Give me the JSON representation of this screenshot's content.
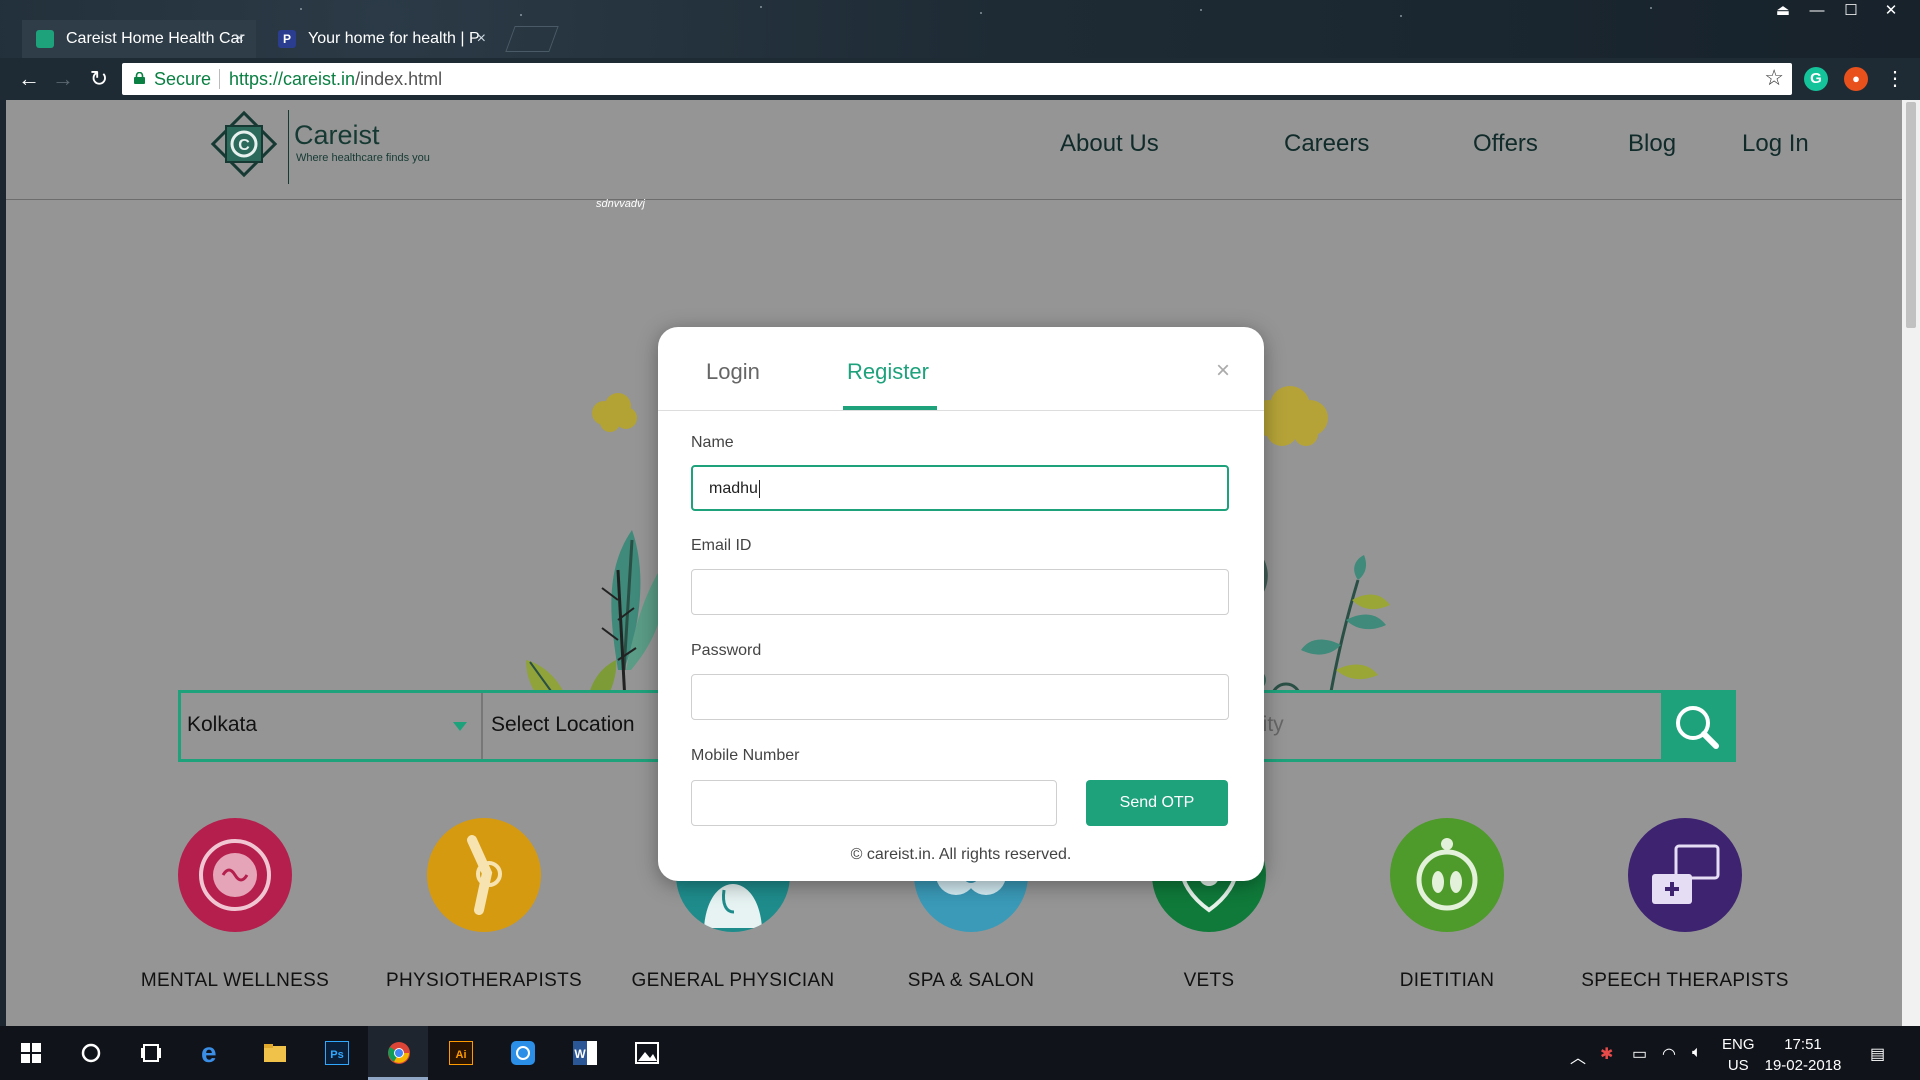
{
  "browser": {
    "tabs": [
      {
        "title": "Careist Home Health Car",
        "active": true
      },
      {
        "title": "Your home for health | P",
        "active": false
      }
    ],
    "secure_label": "Secure",
    "url_host": "https://careist.in",
    "url_path": "/index.html"
  },
  "site": {
    "logo_name": "Careist",
    "logo_tagline": "Where healthcare finds you",
    "nav": [
      "About Us",
      "Careers",
      "Offers",
      "Blog",
      "Log In"
    ],
    "handwritten": "sdnvvadvj"
  },
  "search": {
    "city": "Kolkata",
    "location_placeholder": "Select Location",
    "specialty_partial": "lity"
  },
  "services": [
    {
      "label": "MENTAL WELLNESS",
      "color": "#b51f4e",
      "icon": "brain-icon"
    },
    {
      "label": "PHYSIOTHERAPISTS",
      "color": "#d59a10",
      "icon": "knee-joint-icon"
    },
    {
      "label": "GENERAL PHYSICIAN",
      "color": "#1f8c8c",
      "icon": "doctor-icon"
    },
    {
      "label": "SPA & SALON",
      "color": "#3a9ab8",
      "icon": "spa-icon"
    },
    {
      "label": "VETS",
      "color": "#0f7a3a",
      "icon": "pet-heart-icon"
    },
    {
      "label": "DIETITIAN",
      "color": "#4e9a2a",
      "icon": "scale-icon"
    },
    {
      "label": "SPEECH THERAPISTS",
      "color": "#3e2370",
      "icon": "speech-icon"
    }
  ],
  "modal": {
    "tab_login": "Login",
    "tab_register": "Register",
    "close": "×",
    "fields": {
      "name_label": "Name",
      "name_value": "madhu",
      "email_label": "Email ID",
      "password_label": "Password",
      "mobile_label": "Mobile Number"
    },
    "send_otp": "Send OTP",
    "copyright": "© careist.in. All rights reserved."
  },
  "taskbar": {
    "lang_1": "ENG",
    "lang_2": "US",
    "time": "17:51",
    "date": "19-02-2018"
  },
  "colors": {
    "brand_green": "#1ea27c",
    "page_overlay": "#959595"
  }
}
